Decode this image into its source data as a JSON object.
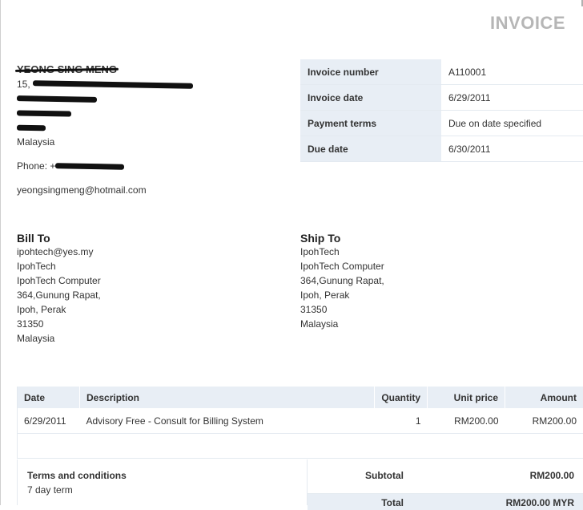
{
  "header": {
    "title": "INVOICE"
  },
  "sender": {
    "name": "YEONG SING MENG",
    "address_line1_prefix": "15,",
    "country": "Malaysia",
    "phone_label": "Phone: +",
    "email": "yeongsingmeng@hotmail.com"
  },
  "meta": [
    {
      "label": "Invoice number",
      "value": "A110001"
    },
    {
      "label": "Invoice date",
      "value": "6/29/2011"
    },
    {
      "label": "Payment terms",
      "value": "Due on date specified"
    },
    {
      "label": "Due date",
      "value": "6/30/2011"
    }
  ],
  "bill_to": {
    "heading": "Bill To",
    "lines": [
      "ipohtech@yes.my",
      "IpohTech",
      "IpohTech Computer",
      "364,Gunung Rapat,",
      "Ipoh, Perak",
      "31350",
      "Malaysia"
    ]
  },
  "ship_to": {
    "heading": "Ship To",
    "lines": [
      "IpohTech",
      "IpohTech Computer",
      "364,Gunung Rapat,",
      "Ipoh, Perak",
      "31350",
      "Malaysia"
    ]
  },
  "items": {
    "headers": [
      "Date",
      "Description",
      "Quantity",
      "Unit price",
      "Amount"
    ],
    "rows": [
      [
        "6/29/2011",
        "Advisory Free - Consult for Billing System",
        "1",
        "RM200.00",
        "RM200.00"
      ]
    ]
  },
  "terms": {
    "label": "Terms and conditions",
    "value": "7 day term"
  },
  "totals": {
    "subtotal_label": "Subtotal",
    "subtotal": "RM200.00",
    "total_label": "Total",
    "total": "RM200.00 MYR"
  }
}
